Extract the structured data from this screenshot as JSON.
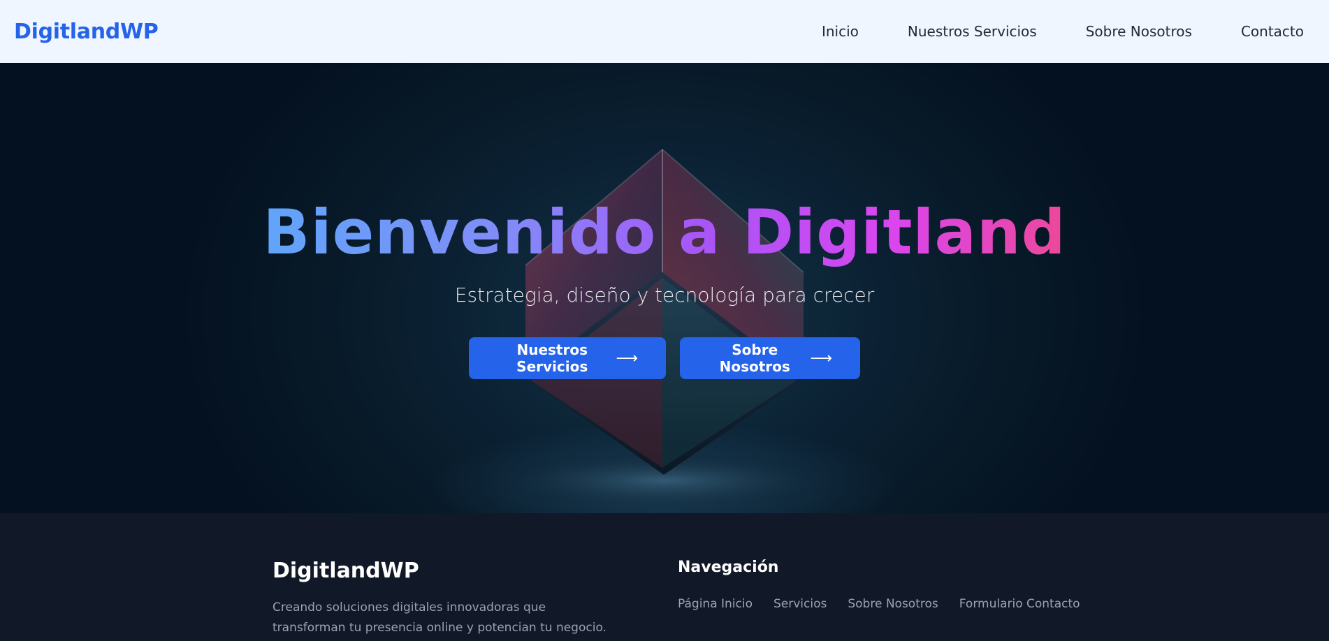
{
  "header": {
    "logo": "DigitlandWP",
    "nav": [
      "Inicio",
      "Nuestros Servicios",
      "Sobre Nosotros",
      "Contacto"
    ]
  },
  "hero": {
    "title": "Bienvenido a Digitland",
    "subtitle": "Estrategia, diseño y tecnología para crecer",
    "buttons": [
      {
        "label": "Nuestros Servicios",
        "icon": "arrow-right-icon"
      },
      {
        "label": "Sobre Nosotros",
        "icon": "arrow-right-icon"
      }
    ],
    "colors": {
      "button": "#2563eb",
      "gradient_start": "#60a5fa",
      "gradient_end": "#ec4899"
    }
  },
  "footer": {
    "brand": "DigitlandWP",
    "description": "Creando soluciones digitales innovadoras que transforman tu presencia online y potencian tu negocio.",
    "nav_title": "Navegación",
    "links": [
      "Página Inicio",
      "Servicios",
      "Sobre Nosotros",
      "Formulario Contacto"
    ]
  }
}
